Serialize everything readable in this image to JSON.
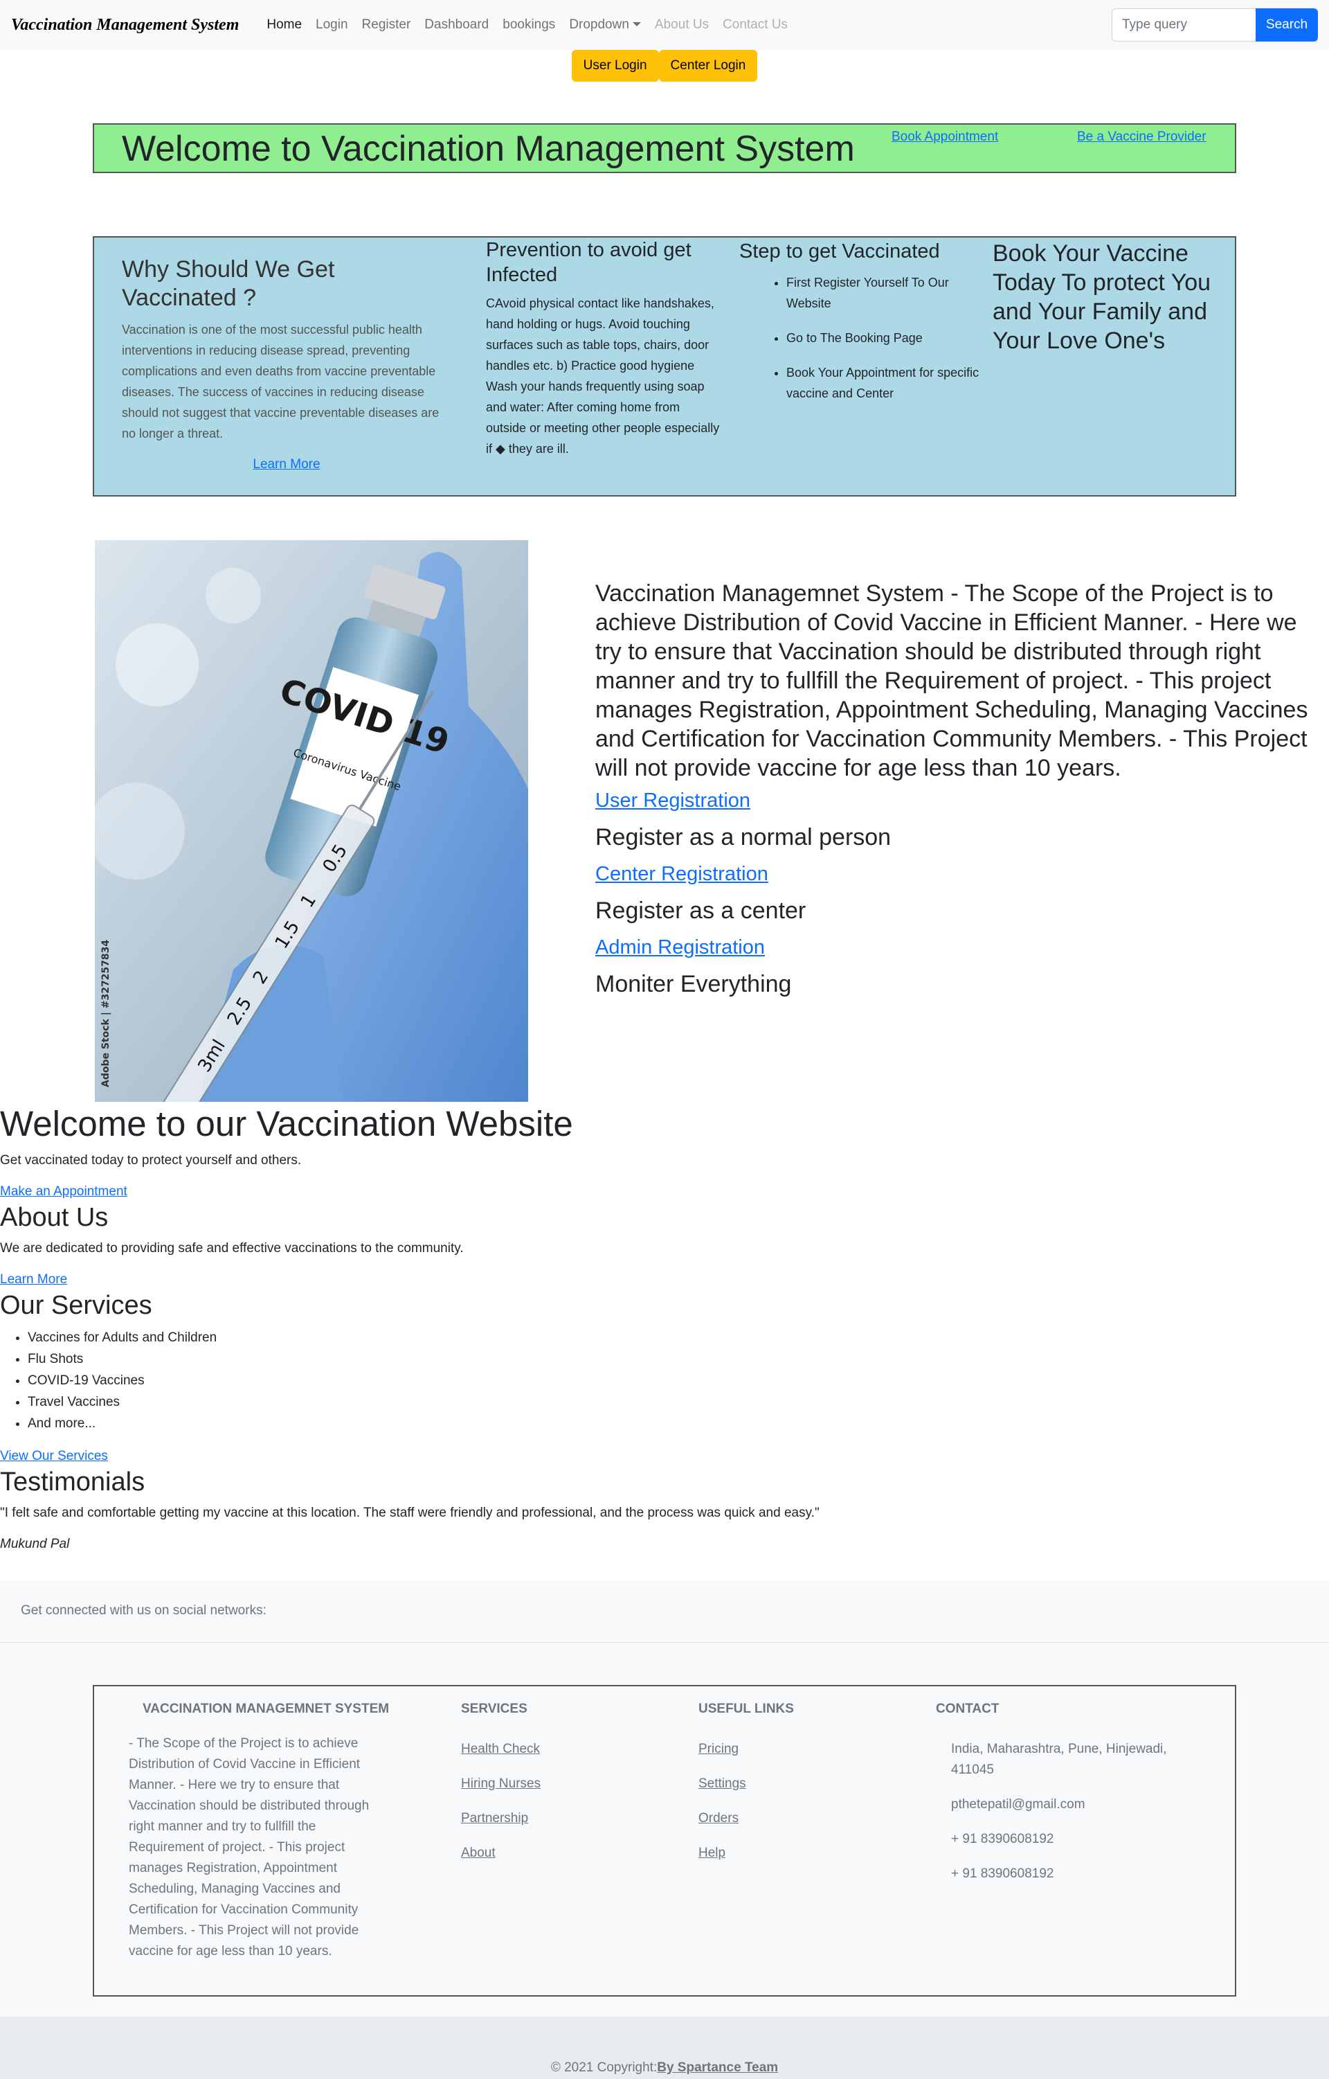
{
  "navbar": {
    "brand": "Vaccination Management System",
    "links": [
      "Home",
      "Login",
      "Register",
      "Dashboard",
      "bookings",
      "Dropdown",
      "About Us",
      "Contact Us"
    ],
    "search_placeholder": "Type query",
    "search_button": "Search"
  },
  "login_buttons": {
    "user": "User Login",
    "center": "Center Login"
  },
  "banner": {
    "title": "Welcome to Vaccination Management System",
    "book_link": "Book Appointment",
    "provider_link": "Be a Vaccine Provider",
    "bg_color": "#90ee90"
  },
  "info": {
    "bg_color": "#add8e6",
    "why": {
      "title": "Why Should We Get Vaccinated ?",
      "text": "Vaccination is one of the most successful public health interventions in reducing disease spread, preventing complications and even deaths from vaccine preventable diseases. The success of vaccines in reducing disease should not suggest that vaccine preventable diseases are no longer a threat.",
      "link": "Learn More"
    },
    "prevention": {
      "title": "Prevention to avoid get Infected",
      "text": "CAvoid physical contact like handshakes, hand holding or hugs. Avoid touching surfaces such as table tops, chairs, door handles etc. b) Practice good hygiene Wash your hands frequently using soap and water: After coming home from outside or meeting other people especially if ◆ they are ill."
    },
    "steps": {
      "title": "Step to get Vaccinated",
      "items": [
        "First Register Yourself To Our Website",
        "Go to The Booking Page",
        "Book Your Appointment for specific vaccine and Center"
      ]
    },
    "book": {
      "title": "Book Your Vaccine Today To protect You and Your Family and Your Love One's"
    }
  },
  "image": {
    "label": "COVID 19",
    "sub": "Coronavirus Vaccine",
    "watermark": "Adobe Stock | #327257834",
    "ticks": [
      "0.5",
      "1",
      "1.5",
      "2",
      "2.5",
      "3ml"
    ]
  },
  "scope": {
    "text": "Vaccination Managemnet System - The Scope of the Project is to achieve Distribution of Covid Vaccine in Efficient Manner. - Here we try to ensure that Vaccination should be distributed through right manner and try to fullfill the Requirement of project. - This project manages Registration, Appointment Scheduling, Managing Vaccines and Certification for Vaccination Community Members. - This Project will not provide vaccine for age less than 10 years.",
    "registrations": [
      {
        "link": "User Registration",
        "desc": "Register as a normal person"
      },
      {
        "link": "Center Registration",
        "desc": "Register as a center"
      },
      {
        "link": "Admin Registration",
        "desc": "Moniter Everything"
      }
    ]
  },
  "lower": {
    "welcome_title": "Welcome to our Vaccination Website",
    "welcome_text": "Get vaccinated today to protect yourself and others.",
    "appointment_link": "Make an Appointment",
    "about_title": "About Us",
    "about_text": "We are dedicated to providing safe and effective vaccinations to the community.",
    "about_link": "Learn More",
    "services_title": "Our Services",
    "services": [
      "Vaccines for Adults and Children",
      "Flu Shots",
      "COVID-19 Vaccines",
      "Travel Vaccines",
      "And more..."
    ],
    "services_link": "View Our Services",
    "testimonials_title": "Testimonials",
    "quote": "\"I felt safe and comfortable getting my vaccine at this location. The staff were friendly and professional, and the process was quick and easy.\"",
    "author": "Mukund Pal"
  },
  "footer": {
    "social_text": "Get connected with us on social networks:",
    "about_title": "Vaccination Managemnet System",
    "about_text": "- The Scope of the Project is to achieve Distribution of Covid Vaccine in Efficient Manner. - Here we try to ensure that Vaccination should be distributed through right manner and try to fullfill the Requirement of project. - This project manages Registration, Appointment Scheduling, Managing Vaccines and Certification for Vaccination Community Members. - This Project will not provide vaccine for age less than 10 years.",
    "services_title": "Services",
    "services": [
      "Health Check",
      "Hiring Nurses",
      "Partnership",
      "About"
    ],
    "links_title": "Useful links",
    "links": [
      "Pricing",
      "Settings",
      "Orders",
      "Help"
    ],
    "contact_title": "Contact",
    "address": "India, Maharashtra, Pune, Hinjewadi, 411045",
    "email": "pthetepatil@gmail.com",
    "phone1": "+ 91 8390608192",
    "phone2": "+ 91 8390608192",
    "copyright": "© 2021 Copyright:",
    "copyright_link": "By Spartance Team"
  }
}
